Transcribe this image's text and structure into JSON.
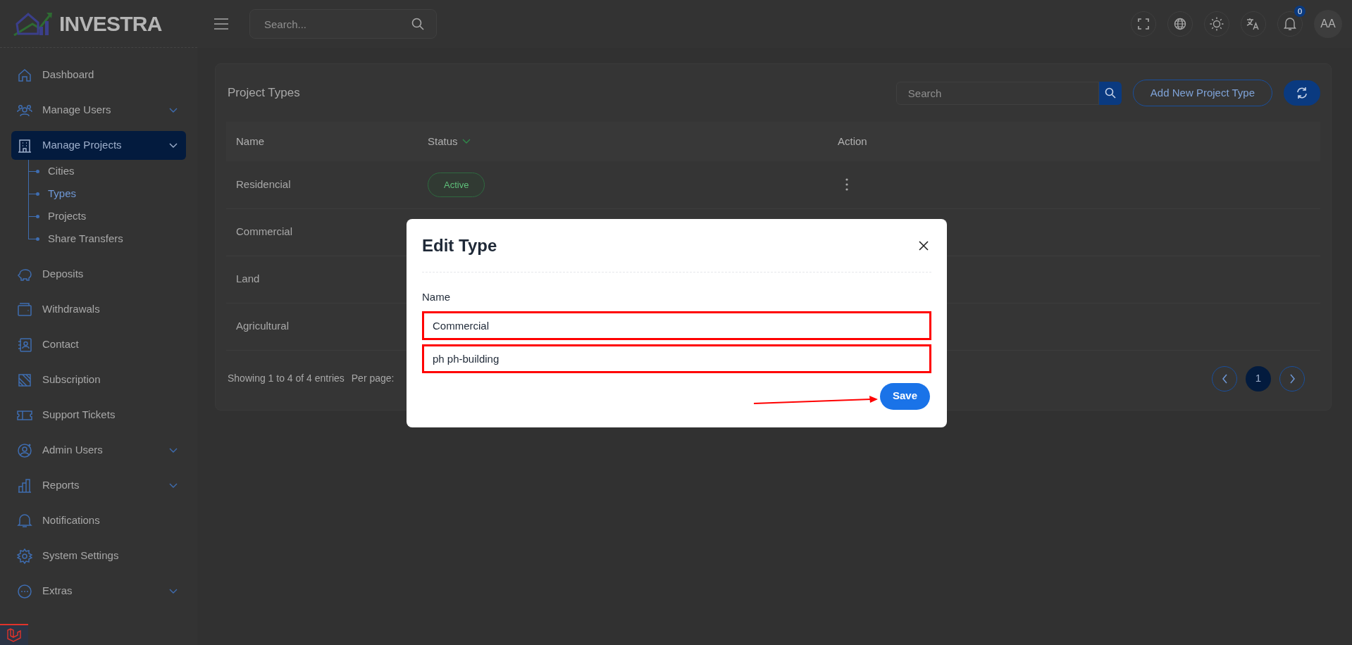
{
  "logo": {
    "text": "INVESTRA"
  },
  "header": {
    "search_placeholder": "Search...",
    "notification_count": "0",
    "avatar": "AA"
  },
  "sidebar": {
    "items": [
      {
        "label": "Dashboard",
        "kind": "link",
        "selected": false
      },
      {
        "label": "Manage Users",
        "kind": "group",
        "selected": false
      },
      {
        "label": "Manage Projects",
        "kind": "group",
        "selected": true,
        "children": [
          {
            "label": "Cities",
            "selected": false
          },
          {
            "label": "Types",
            "selected": true
          },
          {
            "label": "Projects",
            "selected": false
          },
          {
            "label": "Share Transfers",
            "selected": false
          }
        ]
      },
      {
        "label": "Deposits",
        "kind": "link",
        "selected": false
      },
      {
        "label": "Withdrawals",
        "kind": "link",
        "selected": false
      },
      {
        "label": "Contact",
        "kind": "link",
        "selected": false
      },
      {
        "label": "Subscription",
        "kind": "link",
        "selected": false
      },
      {
        "label": "Support Tickets",
        "kind": "link",
        "selected": false
      },
      {
        "label": "Admin Users",
        "kind": "group",
        "selected": false
      },
      {
        "label": "Reports",
        "kind": "group",
        "selected": false
      },
      {
        "label": "Notifications",
        "kind": "link",
        "selected": false
      },
      {
        "label": "System Settings",
        "kind": "link",
        "selected": false
      },
      {
        "label": "Extras",
        "kind": "group",
        "selected": false
      }
    ]
  },
  "page": {
    "title": "Project Types",
    "search_placeholder": "Search",
    "add_button": "Add New Project Type",
    "table": {
      "columns": [
        "Name",
        "Status",
        "Action"
      ],
      "rows": [
        {
          "name": "Residencial",
          "status": "Active"
        },
        {
          "name": "Commercial"
        },
        {
          "name": "Land"
        },
        {
          "name": "Agricultural"
        }
      ]
    },
    "footer": "Showing 1 to 4 of 4 entries",
    "per_page_label": "Per page:",
    "pagination": [
      {
        "label": "1",
        "selected": true
      }
    ]
  },
  "modal": {
    "title": "Edit Type",
    "field_label": "Name",
    "fields": [
      {
        "value": "Commercial",
        "highlighted": true
      },
      {
        "value": "ph ph-building",
        "highlighted": true
      }
    ],
    "save_button": "Save",
    "arrow_annotation": true
  }
}
